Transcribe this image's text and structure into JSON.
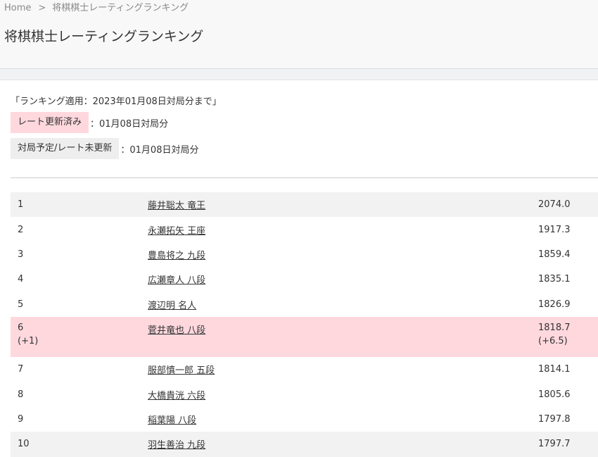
{
  "breadcrumb": {
    "home": "Home",
    "separator": ">",
    "current": "将棋棋士レーティングランキング"
  },
  "page_title": "将棋棋士レーティングランキング",
  "applied_text": "「ランキング適用：2023年01月08日対局分まで」",
  "legend": {
    "updated_label": "レート更新済み",
    "updated_desc": "：01月08日対局分",
    "pending_label": "対局予定/レート未更新",
    "pending_desc": "：01月08日対局分"
  },
  "colors": {
    "updated_highlight": "#ffd8de",
    "alt_row": "#f2f2f2",
    "pending_box": "#eeeeee"
  },
  "ranking": [
    {
      "rank": "1",
      "name": "藤井聡太 竜王",
      "rating": "2074.0"
    },
    {
      "rank": "2",
      "name": "永瀬拓矢 王座",
      "rating": "1917.3"
    },
    {
      "rank": "3",
      "name": "豊島将之 九段",
      "rating": "1859.4"
    },
    {
      "rank": "4",
      "name": "広瀬章人 八段",
      "rating": "1835.1"
    },
    {
      "rank": "5",
      "name": "渡辺明 名人",
      "rating": "1826.9"
    },
    {
      "rank": "6",
      "rank_change": "(+1)",
      "name": "菅井竜也 八段",
      "rating": "1818.7",
      "rating_change": "(+6.5)"
    },
    {
      "rank": "7",
      "name": "服部慎一郎 五段",
      "rating": "1814.1"
    },
    {
      "rank": "8",
      "name": "大橋貴洸 六段",
      "rating": "1805.6"
    },
    {
      "rank": "9",
      "name": "稲葉陽 八段",
      "rating": "1797.8"
    },
    {
      "rank": "10",
      "name": "羽生善治 九段",
      "rating": "1797.7"
    }
  ]
}
